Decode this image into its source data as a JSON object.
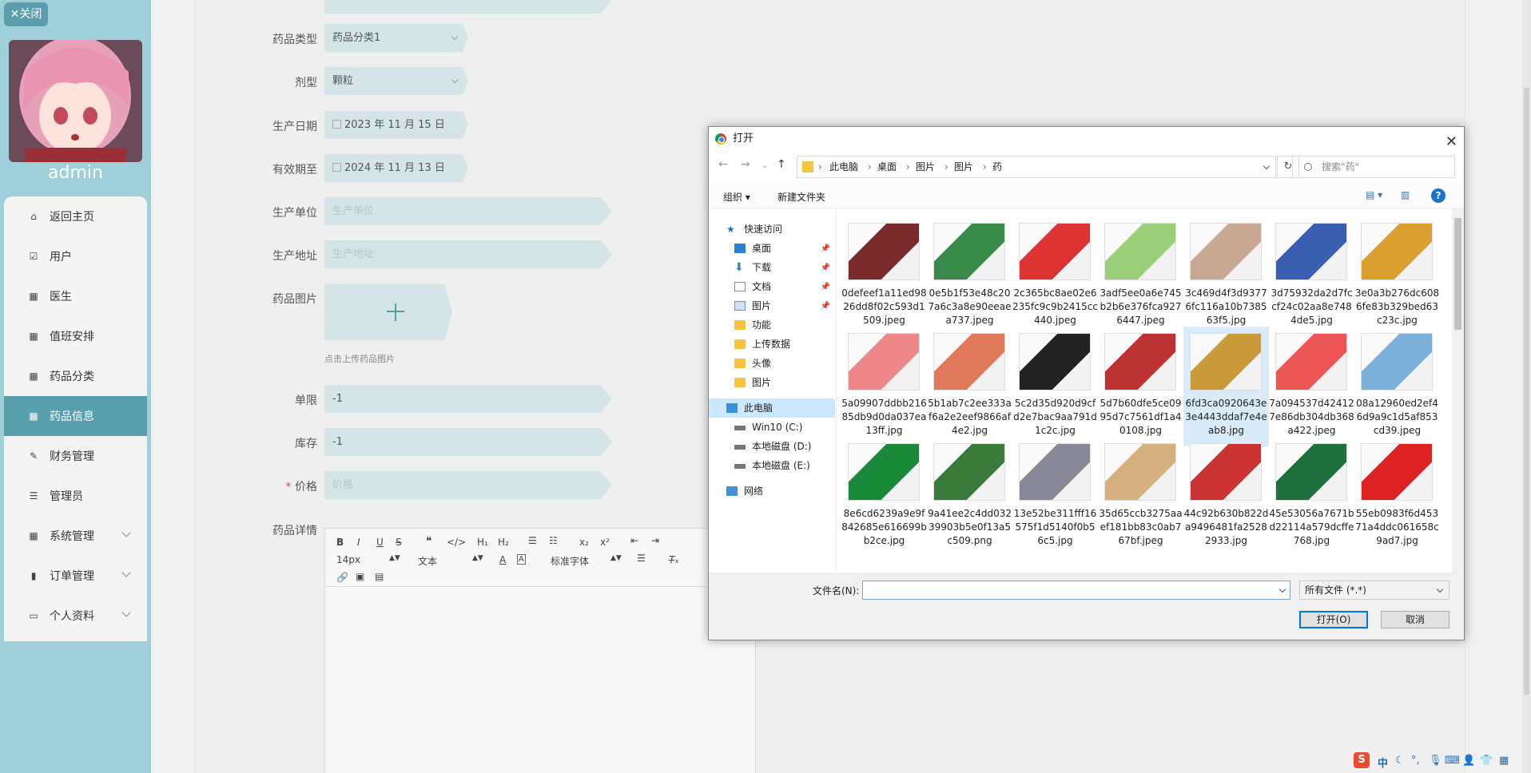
{
  "sidebar": {
    "close_label": "✕关闭",
    "admin_name": "admin",
    "menu": [
      {
        "label": "返回主页",
        "icon": "home-icon"
      },
      {
        "label": "用户",
        "icon": "checkbox-icon"
      },
      {
        "label": "医生",
        "icon": "grid-icon"
      },
      {
        "label": "值班安排",
        "icon": "grid-icon"
      },
      {
        "label": "药品分类",
        "icon": "grid-icon"
      },
      {
        "label": "药品信息",
        "icon": "grid-icon",
        "active": true
      },
      {
        "label": "财务管理",
        "icon": "edit-icon"
      },
      {
        "label": "管理员",
        "icon": "list-icon"
      },
      {
        "label": "系统管理",
        "icon": "grid-icon",
        "expandable": true
      },
      {
        "label": "订单管理",
        "icon": "chart-icon",
        "expandable": true
      },
      {
        "label": "个人资料",
        "icon": "card-icon",
        "expandable": true
      }
    ]
  },
  "form": {
    "type_label": "药品类型",
    "type_value": "药品分类1",
    "form_label": "剂型",
    "form_value": "颗粒",
    "mfg_date_label": "生产日期",
    "mfg_date_value": "2023 年 11 月 15 日",
    "expiry_label": "有效期至",
    "expiry_value": "2024 年 11 月 13 日",
    "maker_label": "生产单位",
    "maker_placeholder": "生产单位",
    "address_label": "生产地址",
    "address_placeholder": "生产地址",
    "image_label": "药品图片",
    "upload_hint": "点击上传药品图片",
    "limit_label": "单限",
    "limit_value": "-1",
    "stock_label": "库存",
    "stock_value": "-1",
    "price_label": "价格",
    "price_required": "*",
    "price_placeholder": "价格",
    "detail_label": "药品详情",
    "editor": {
      "font_size": "14px",
      "text_style": "文本",
      "font_family": "标准字体"
    }
  },
  "dialog": {
    "title": "打开",
    "path": [
      "此电脑",
      "桌面",
      "图片",
      "图片",
      "药"
    ],
    "search_placeholder": "搜索\"药\"",
    "organize": "组织 ▾",
    "new_folder": "新建文件夹",
    "nav": [
      {
        "label": "快速访问",
        "kind": "star",
        "pinned": false
      },
      {
        "label": "桌面",
        "kind": "desktop",
        "pinned": true
      },
      {
        "label": "下载",
        "kind": "download",
        "pinned": true
      },
      {
        "label": "文档",
        "kind": "doc",
        "pinned": true
      },
      {
        "label": "图片",
        "kind": "pic",
        "pinned": true
      },
      {
        "label": "功能",
        "kind": "folder",
        "pinned": false
      },
      {
        "label": "上传数据",
        "kind": "folder",
        "pinned": false
      },
      {
        "label": "头像",
        "kind": "folder",
        "pinned": false
      },
      {
        "label": "图片",
        "kind": "folder",
        "pinned": false
      },
      {
        "label": "此电脑",
        "kind": "pc",
        "pinned": false,
        "selected": true
      },
      {
        "label": "Win10 (C:)",
        "kind": "drive",
        "pinned": false
      },
      {
        "label": "本地磁盘 (D:)",
        "kind": "drive",
        "pinned": false
      },
      {
        "label": "本地磁盘 (E:)",
        "kind": "drive",
        "pinned": false
      },
      {
        "label": "网络",
        "kind": "net",
        "pinned": false
      }
    ],
    "files": [
      {
        "name": "0defeef1a11ed9826dd8f02c593d1509.jpeg",
        "color": "#7b2b2b"
      },
      {
        "name": "0e5b1f53e48c207a6c3a8e90eeaea737.jpeg",
        "color": "#3a8a4a"
      },
      {
        "name": "2c365bc8ae02e6235fc9c9b2415cc440.jpeg",
        "color": "#d33"
      },
      {
        "name": "3adf5ee0a6e745b2b6e376fca9276447.jpeg",
        "color": "#9ccf7a"
      },
      {
        "name": "3c469d4f3d93776fc116a10b738563f5.jpg",
        "color": "#c9a892"
      },
      {
        "name": "3d75932da2d7fccf24c02aa8e7484de5.jpg",
        "color": "#3b5fb0"
      },
      {
        "name": "3e0a3b276dc6086fe83b329bed63c23c.jpg",
        "color": "#d9a030"
      },
      {
        "name": "5a09907ddbb21685db9d0da037ea13ff.jpg",
        "color": "#e88"
      },
      {
        "name": "5b1ab7c2ee333af6a2e2eef9866af4e2.jpg",
        "color": "#e07a5a"
      },
      {
        "name": "5c2d35d920d9cfd2e7bac9aa791d1c2c.jpg",
        "color": "#222"
      },
      {
        "name": "5d7b60dfe5ce0995d7c7561df1a40108.jpg",
        "color": "#b33"
      },
      {
        "name": "6fd3ca0920643e3e4443ddaf7e4eab8.jpg",
        "color": "#c99a3a",
        "selected": true
      },
      {
        "name": "7a094537d424127e86db304db368a422.jpeg",
        "color": "#e55"
      },
      {
        "name": "08a12960ed2ef46d9a9c1d5af853cd39.jpeg",
        "color": "#7ab0d9"
      },
      {
        "name": "8e6cd6239a9e9f842685e616699bb2ce.jpg",
        "color": "#1a8a3a"
      },
      {
        "name": "9a41ee2c4dd03239903b5e0f13a5c509.png",
        "color": "#3a7a3a"
      },
      {
        "name": "13e52be311fff16575f1d5140f0b56c5.jpg",
        "color": "#889"
      },
      {
        "name": "35d65ccb3275aaef181bb83c0ab767bf.jpeg",
        "color": "#d5b080"
      },
      {
        "name": "44c92b630b822da9496481fa25282933.jpg",
        "color": "#c33"
      },
      {
        "name": "45e53056a7671bd22114a579dcffe768.jpg",
        "color": "#1f6f3f"
      },
      {
        "name": "55eb0983f6d45371a4ddc061658c9ad7.jpg",
        "color": "#d22"
      }
    ],
    "filename_label": "文件名(N):",
    "filename_value": "",
    "filetype": "所有文件 (*.*)",
    "open_label": "打开(O)",
    "cancel_label": "取消"
  },
  "tray": {
    "ime": "中"
  }
}
